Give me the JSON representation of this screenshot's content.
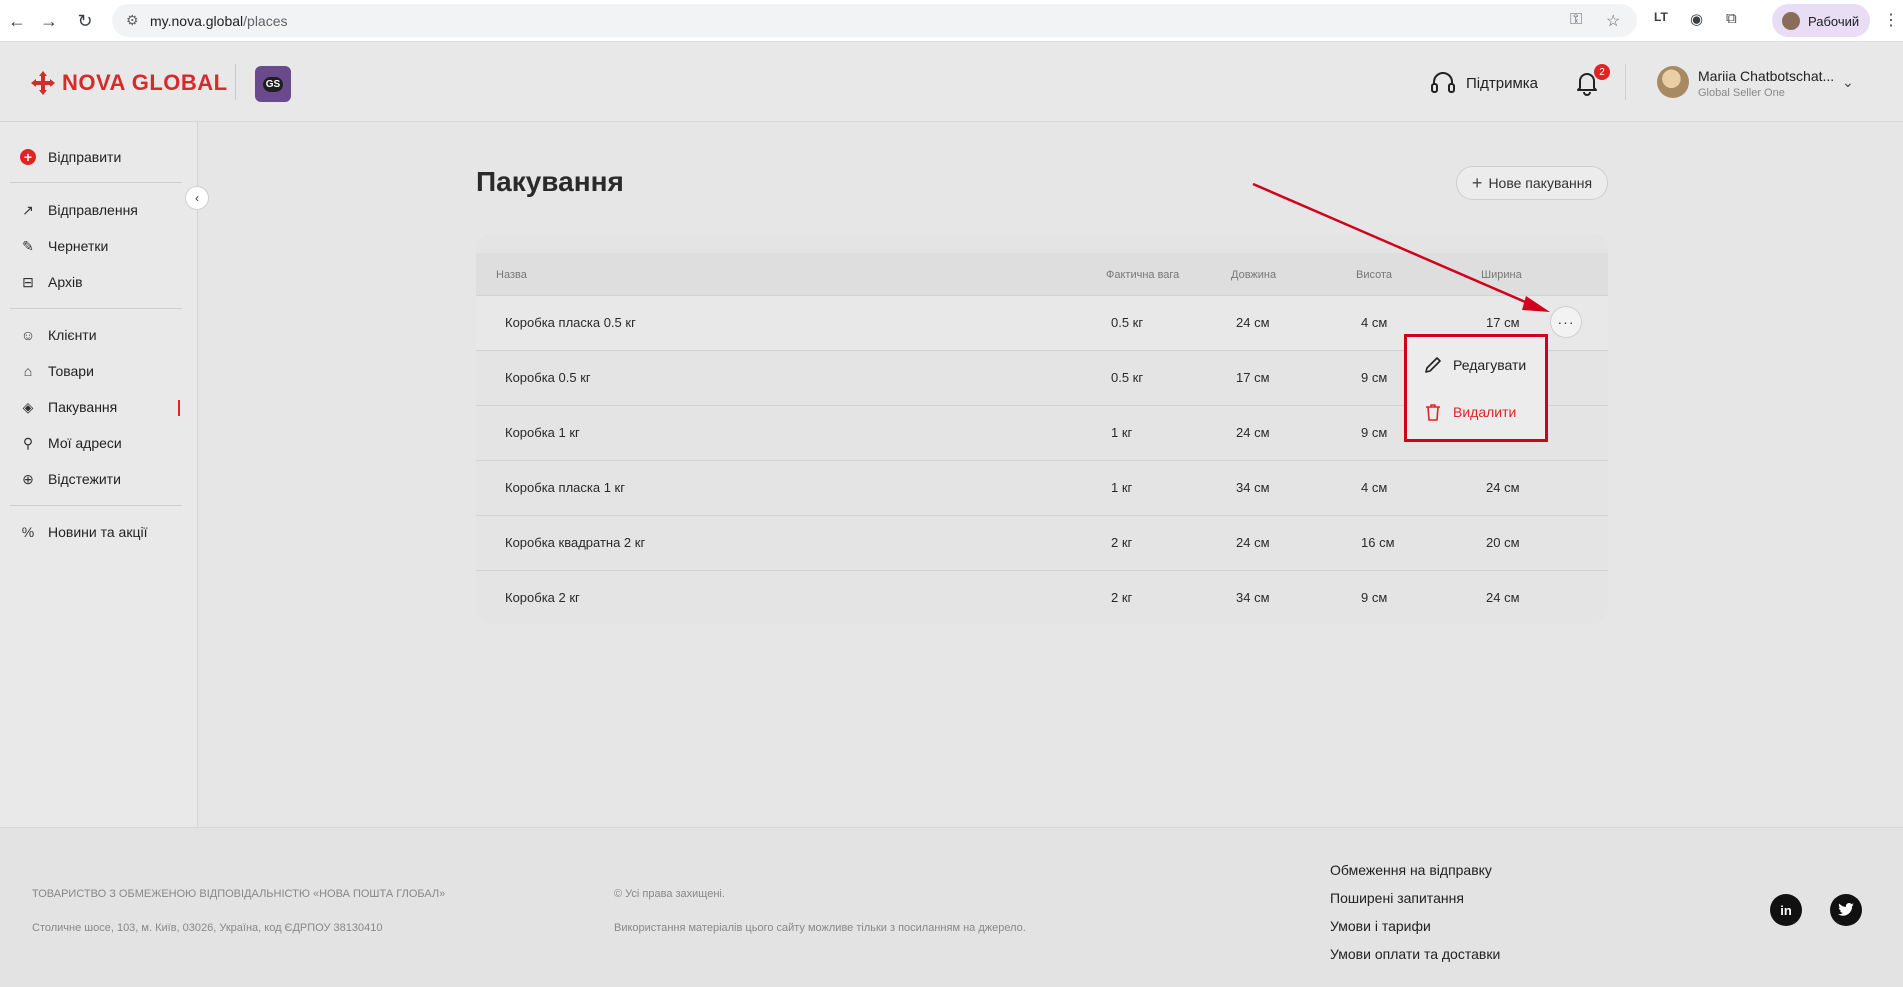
{
  "browser": {
    "url_host": "my.nova.global",
    "url_path": "/places",
    "profile_label": "Рабочий"
  },
  "header": {
    "logo_text": "NOVA GLOBAL",
    "gs_badge": "GS",
    "support_label": "Підтримка",
    "notifications_count": "2",
    "user_name": "Mariia Chatbotschat...",
    "user_role": "Global Seller One"
  },
  "sidebar": {
    "send_label": "Відправити",
    "items": [
      {
        "label": "Відправлення"
      },
      {
        "label": "Чернетки"
      },
      {
        "label": "Архів"
      },
      {
        "label": "Клієнти"
      },
      {
        "label": "Товари"
      },
      {
        "label": "Пакування"
      },
      {
        "label": "Мої адреси"
      },
      {
        "label": "Відстежити"
      },
      {
        "label": "Новини та акції"
      }
    ]
  },
  "main": {
    "title": "Пакування",
    "new_button": "Нове пакування",
    "columns": [
      "Назва",
      "Фактична вага",
      "Довжина",
      "Висота",
      "Ширина"
    ],
    "rows": [
      {
        "name": "Коробка пласка 0.5 кг",
        "weight": "0.5 кг",
        "length": "24 см",
        "height": "4 см",
        "width": "17 см"
      },
      {
        "name": "Коробка 0.5 кг",
        "weight": "0.5 кг",
        "length": "17 см",
        "height": "9 см",
        "width": ""
      },
      {
        "name": "Коробка 1 кг",
        "weight": "1 кг",
        "length": "24 см",
        "height": "9 см",
        "width": ""
      },
      {
        "name": "Коробка пласка 1 кг",
        "weight": "1 кг",
        "length": "34 см",
        "height": "4 см",
        "width": "24 см"
      },
      {
        "name": "Коробка квадратна 2 кг",
        "weight": "2 кг",
        "length": "24 см",
        "height": "16 см",
        "width": "20 см"
      },
      {
        "name": "Коробка 2 кг",
        "weight": "2 кг",
        "length": "34 см",
        "height": "9 см",
        "width": "24 см"
      }
    ],
    "menu": {
      "edit": "Редагувати",
      "delete": "Видалити"
    }
  },
  "footer": {
    "company": "ТОВАРИСТВО З ОБМЕЖЕНОЮ ВІДПОВІДАЛЬНІСТЮ «НОВА ПОШТА ГЛОБАЛ»",
    "address": "Столичне шосе, 103, м. Київ, 03026, Україна, код ЄДРПОУ 38130410",
    "rights": "© Усі права захищені.",
    "usage": "Використання матеріалів цього сайту можливе тільки з посиланням на джерело.",
    "links": [
      "Обмеження на відправку",
      "Поширені запитання",
      "Умови і тарифи",
      "Умови оплати та доставки"
    ],
    "social": {
      "linkedin": "in",
      "twitter": "twitter-icon"
    }
  },
  "colors": {
    "brand": "#d52b2b",
    "highlight_border": "#d0021b",
    "arrow": "#d0021b"
  }
}
